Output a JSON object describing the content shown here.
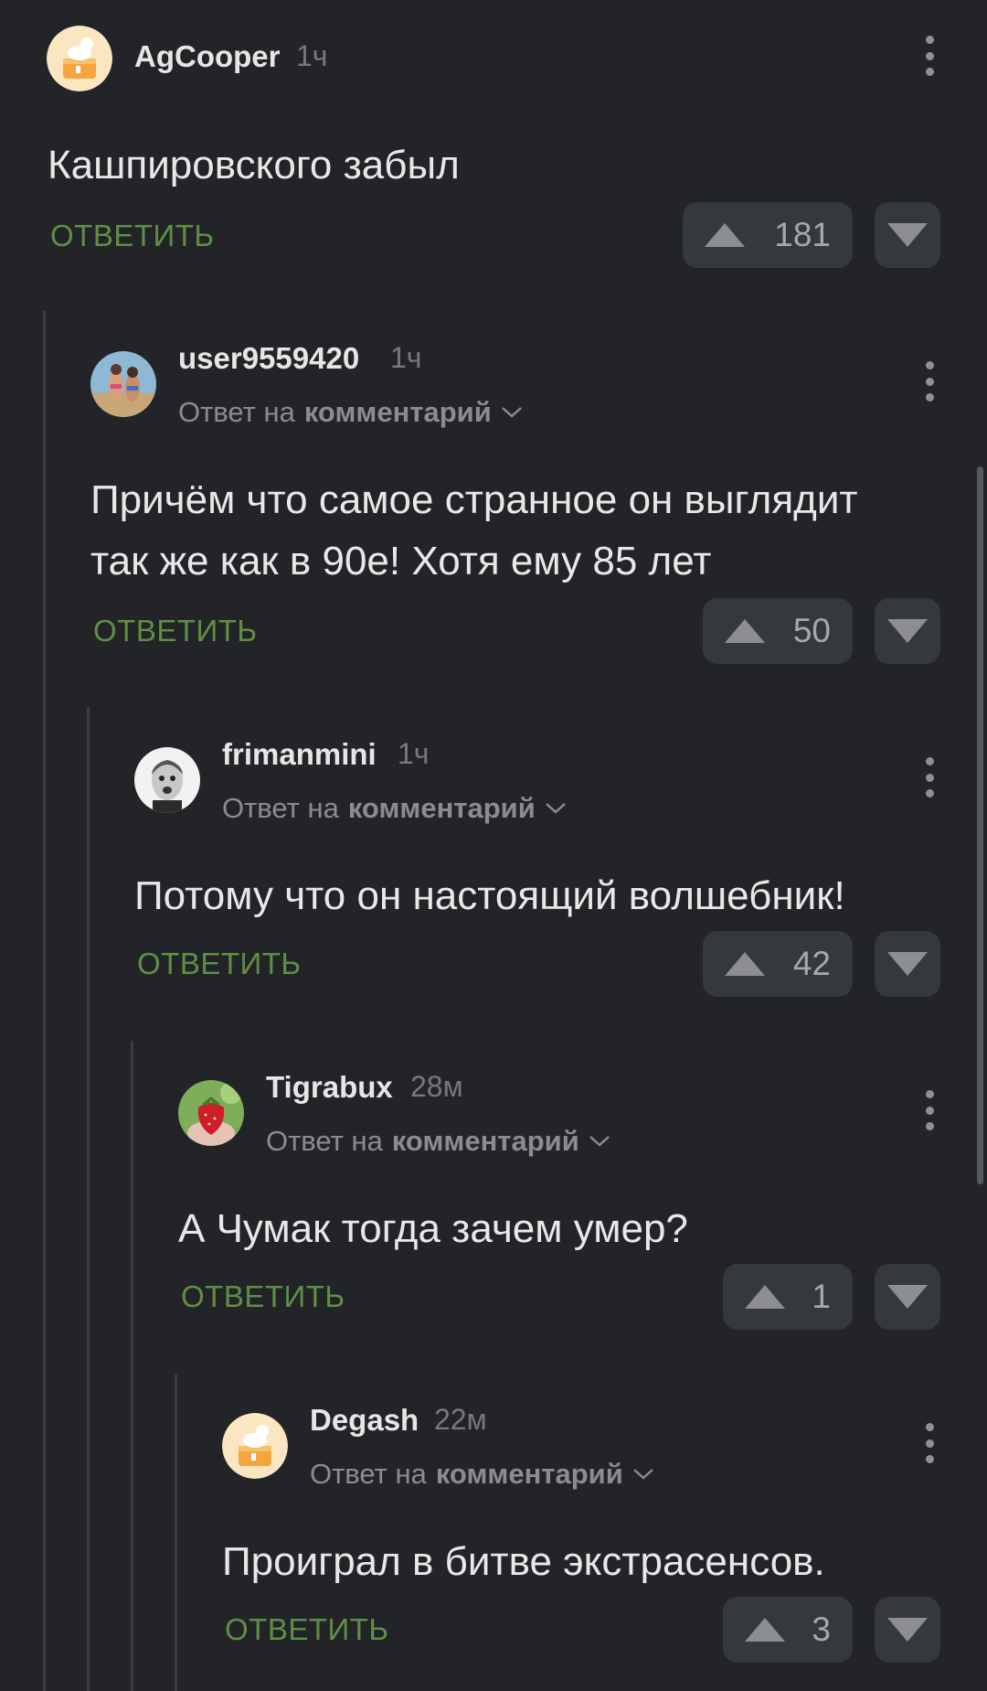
{
  "colors": {
    "background": "#222428",
    "reply_action": "#5f8f45",
    "vote_bg": "#35383d"
  },
  "comments": [
    {
      "username": "AgCooper",
      "time": "1ч",
      "avatar": "cake-avatar",
      "text_lines": [
        "Кашпировского забыл"
      ],
      "reply_label": "ОТВЕТИТЬ",
      "votes": "181"
    },
    {
      "username": "user9559420",
      "time": "1ч",
      "avatar": "photo-avatar",
      "reply_to_prefix": "Ответ на",
      "reply_to_target": "комментарий",
      "text_lines": [
        "Причём что самое странное он выглядит",
        "так же как в 90е! Хотя ему 85 лет"
      ],
      "reply_label": "ОТВЕТИТЬ",
      "votes": "50"
    },
    {
      "username": "frimanmini",
      "time": "1ч",
      "avatar": "photo-avatar",
      "reply_to_prefix": "Ответ на",
      "reply_to_target": "комментарий",
      "text_lines": [
        "Потому что он настоящий волшебник!"
      ],
      "reply_label": "ОТВЕТИТЬ",
      "votes": "42"
    },
    {
      "username": "Tigrabux",
      "time": "28м",
      "avatar": "strawberry-avatar",
      "reply_to_prefix": "Ответ на",
      "reply_to_target": "комментарий",
      "text_lines": [
        "А Чумак тогда зачем умер?"
      ],
      "reply_label": "ОТВЕТИТЬ",
      "votes": "1"
    },
    {
      "username": "Degash",
      "time": "22м",
      "avatar": "cake-avatar",
      "reply_to_prefix": "Ответ на",
      "reply_to_target": "комментарий",
      "text_lines": [
        "Проиграл в битве экстрасенсов."
      ],
      "reply_label": "ОТВЕТИТЬ",
      "votes": "3"
    }
  ]
}
